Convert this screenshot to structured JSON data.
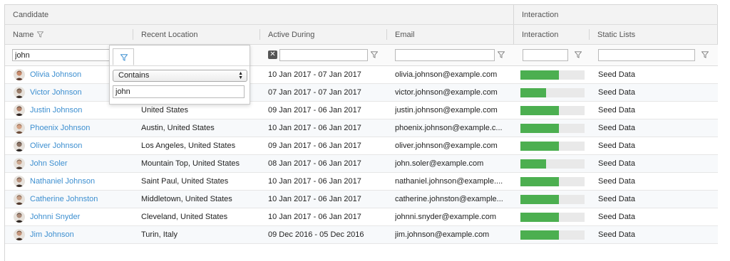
{
  "header": {
    "groups": [
      {
        "label": "Candidate"
      },
      {
        "label": "Interaction"
      }
    ],
    "columns": [
      {
        "label": "Name",
        "filter_icon": "funnel-icon"
      },
      {
        "label": "Recent Location"
      },
      {
        "label": "Active During"
      },
      {
        "label": "Email"
      },
      {
        "label": "Interaction"
      },
      {
        "label": "Static Lists"
      }
    ]
  },
  "filters": {
    "name_value": "john",
    "location_value": "",
    "active_value": "",
    "email_value": "",
    "interaction_value": "",
    "lists_value": ""
  },
  "filter_popup": {
    "operator": "Contains",
    "value": "john"
  },
  "colors": {
    "bar_fill": "#4caf50",
    "bar_track": "#e9e9e9",
    "link": "#3d8fd0"
  },
  "rows": [
    {
      "name": "Olivia Johnson",
      "location": "",
      "active": "10 Jan 2017 - 07 Jan 2017",
      "email": "olivia.johnson@example.com",
      "interaction": 0.6,
      "lists": "Seed Data"
    },
    {
      "name": "Victor Johnson",
      "location": "",
      "active": "07 Jan 2017 - 07 Jan 2017",
      "email": "victor.johnson@example.com",
      "interaction": 0.4,
      "lists": "Seed Data"
    },
    {
      "name": "Justin Johnson",
      "location": "United States",
      "active": "09 Jan 2017 - 06 Jan 2017",
      "email": "justin.johnson@example.com",
      "interaction": 0.6,
      "lists": "Seed Data"
    },
    {
      "name": "Phoenix Johnson",
      "location": "Austin, United States",
      "active": "10 Jan 2017 - 06 Jan 2017",
      "email": "phoenix.johnson@example.c...",
      "interaction": 0.6,
      "lists": "Seed Data"
    },
    {
      "name": "Oliver Johnson",
      "location": "Los Angeles, United States",
      "active": "09 Jan 2017 - 06 Jan 2017",
      "email": "oliver.johnson@example.com",
      "interaction": 0.6,
      "lists": "Seed Data"
    },
    {
      "name": "John Soler",
      "location": "Mountain Top, United States",
      "active": "08 Jan 2017 - 06 Jan 2017",
      "email": "john.soler@example.com",
      "interaction": 0.4,
      "lists": "Seed Data"
    },
    {
      "name": "Nathaniel Johnson",
      "location": "Saint Paul, United States",
      "active": "10 Jan 2017 - 06 Jan 2017",
      "email": "nathaniel.johnson@example....",
      "interaction": 0.6,
      "lists": "Seed Data"
    },
    {
      "name": "Catherine Johnston",
      "location": "Middletown, United States",
      "active": "10 Jan 2017 - 06 Jan 2017",
      "email": "catherine.johnston@example...",
      "interaction": 0.6,
      "lists": "Seed Data"
    },
    {
      "name": "Johnni Snyder",
      "location": "Cleveland, United States",
      "active": "10 Jan 2017 - 06 Jan 2017",
      "email": "johnni.snyder@example.com",
      "interaction": 0.6,
      "lists": "Seed Data"
    },
    {
      "name": "Jim Johnson",
      "location": "Turin, Italy",
      "active": "09 Dec 2016 - 05 Dec 2016",
      "email": "jim.johnson@example.com",
      "interaction": 0.6,
      "lists": "Seed Data"
    }
  ]
}
